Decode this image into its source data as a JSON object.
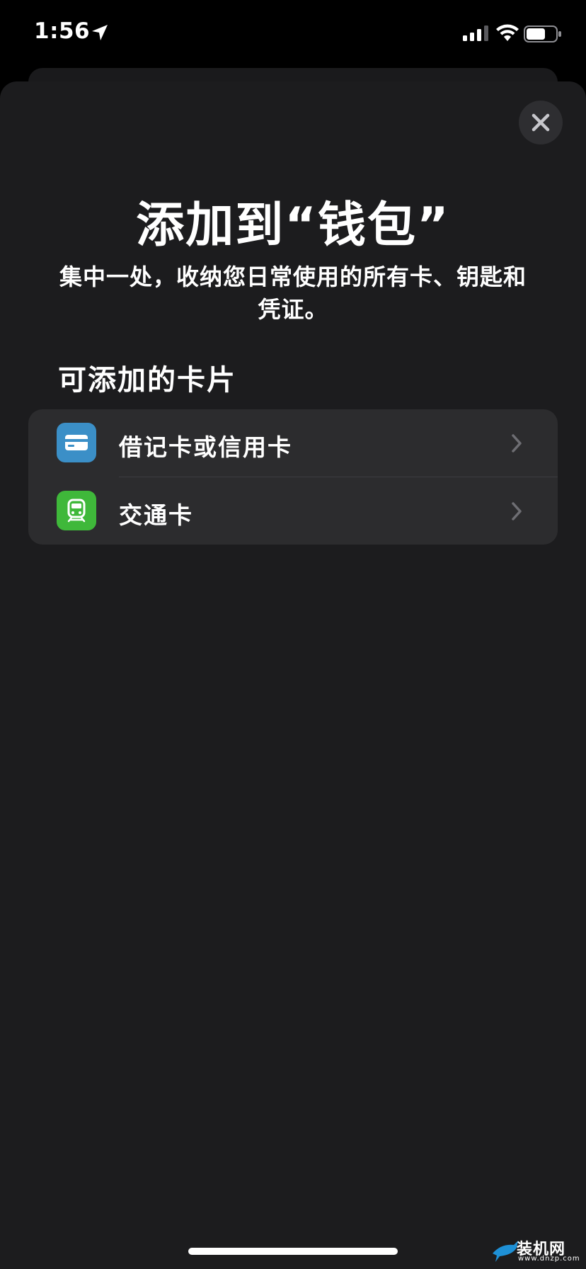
{
  "status_bar": {
    "time": "1:56"
  },
  "sheet": {
    "title": "添加到“钱包”",
    "subtitle": "集中一处，收纳您日常使用的所有卡、钥匙和凭证。",
    "section_header": "可添加的卡片",
    "items": [
      {
        "label": "借记卡或信用卡",
        "icon": "credit-card-icon",
        "icon_color": "#3b8fc7"
      },
      {
        "label": "交通卡",
        "icon": "train-icon",
        "icon_color": "#3fb83a"
      }
    ]
  },
  "watermark": {
    "text": "装机网",
    "url": "www.dnzp.com"
  }
}
